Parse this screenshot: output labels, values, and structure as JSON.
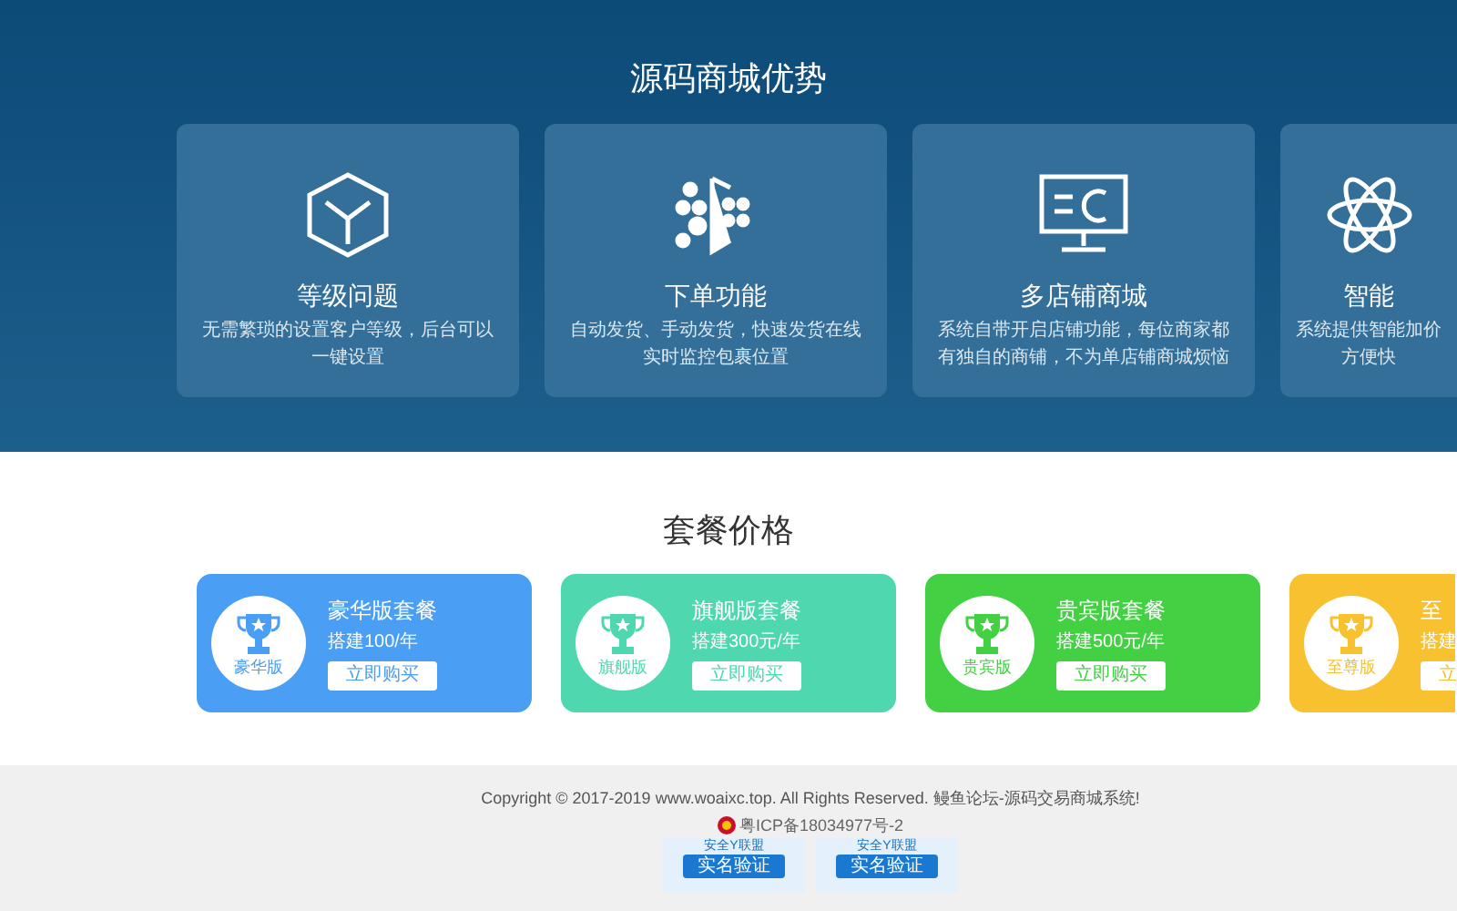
{
  "features": {
    "title": "源码商城优势",
    "items": [
      {
        "kind": "cube",
        "title": "等级问题",
        "lines": [
          "无需繁琐的设置客户等级，后台可以",
          "一键设置"
        ]
      },
      {
        "kind": "dots",
        "title": "下单功能",
        "lines": [
          "自动发货、手动发货，快速发货在线",
          "实时监控包裹位置"
        ]
      },
      {
        "kind": "monitor",
        "title": "多店铺商城",
        "lines": [
          "系统自带开启店铺功能，每位商家都",
          "有独自的商铺，不为单店铺商城烦恼"
        ]
      },
      {
        "kind": "atom",
        "title": "智能",
        "lines": [
          "系统提供智能加价",
          "方便快"
        ]
      }
    ]
  },
  "pricing": {
    "title": "套餐价格",
    "plans": [
      {
        "name": "豪华版套餐",
        "badge": "豪华版",
        "price": "搭建100/年",
        "button": "立即购买",
        "color": "#4a9ff5"
      },
      {
        "name": "旗舰版套餐",
        "badge": "旗舰版",
        "price": "搭建300元/年",
        "button": "立即购买",
        "color": "#4fd8b0"
      },
      {
        "name": "贵宾版套餐",
        "badge": "贵宾版",
        "price": "搭建500元/年",
        "button": "立即购买",
        "color": "#43d143"
      },
      {
        "name": "至",
        "badge": "至尊版",
        "price": "搭建",
        "button": "立",
        "color": "#f7c12f"
      }
    ]
  },
  "footer": {
    "copyright": "Copyright © 2017-2019 www.woaixc.top. All Rights Reserved. 鳗鱼论坛-源码交易商城系统!",
    "icp": "粤ICP备18034977号-2",
    "badges": [
      {
        "top": "安全Y联盟",
        "main": "实名验证"
      },
      {
        "top": "安全Y联盟",
        "main": "实名验证"
      }
    ]
  }
}
